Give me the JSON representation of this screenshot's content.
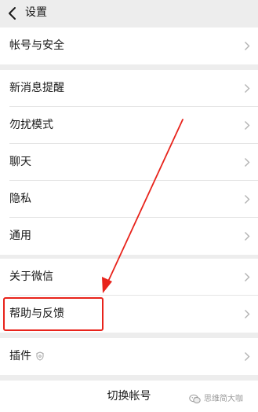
{
  "header": {
    "title": "设置"
  },
  "sections": [
    {
      "items": [
        {
          "label": "帐号与安全"
        }
      ]
    },
    {
      "items": [
        {
          "label": "新消息提醒"
        },
        {
          "label": "勿扰模式"
        },
        {
          "label": "聊天"
        },
        {
          "label": "隐私"
        },
        {
          "label": "通用"
        }
      ]
    },
    {
      "items": [
        {
          "label": "关于微信"
        },
        {
          "label": "帮助与反馈"
        }
      ]
    },
    {
      "items": [
        {
          "label": "插件"
        }
      ]
    }
  ],
  "footer": {
    "switch_account_label": "切换帐号"
  },
  "annotation": {
    "color": "#e8231b",
    "highlighted_item": "帮助与反馈"
  },
  "watermark": {
    "text": "思维简大咖"
  },
  "icons": {
    "back": "chevron-left-icon",
    "row_arrow": "chevron-right-icon",
    "plugin_badge": "shield-icon",
    "watermark": "wechat-official-account-icon"
  }
}
